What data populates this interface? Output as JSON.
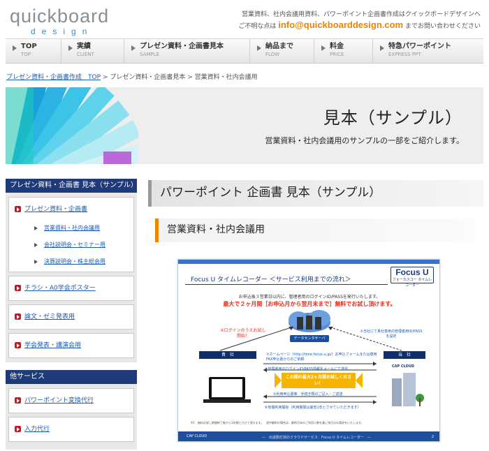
{
  "header": {
    "logo_main": "quickboard",
    "logo_sub": "design",
    "tagline": "営業資料、社内会議用資料、パワーポイント企画書作成はクイックボードデザインへ",
    "contact_prefix": "ご不明な点は",
    "contact_email": "info@quickboarddesign.com",
    "contact_suffix": "までお問い合わせください"
  },
  "nav": [
    {
      "label": "TOP",
      "sub": "TOP"
    },
    {
      "label": "実績",
      "sub": "CLIENT"
    },
    {
      "label": "プレゼン資料・企画書見本",
      "sub": "SAMPLE"
    },
    {
      "label": "納品まで",
      "sub": "FLOW"
    },
    {
      "label": "料金",
      "sub": "PRICE"
    },
    {
      "label": "特急パワーポイント",
      "sub": "EXPRESS PPT"
    }
  ],
  "breadcrumb": {
    "home": "プレゼン資料・企画書作成　TOP",
    "sep": ">",
    "level2": "プレゼン資料・企画書見本",
    "current": "営業資料・社内会議用"
  },
  "hero": {
    "title": "見本（サンプル）",
    "subtitle": "営業資料・社内会議用のサンプルの一部をご紹介します。"
  },
  "sidebar": {
    "section1_title": "プレゼン資料・企画書 見本（サンプル）",
    "main_link": "プレゼン資料・企画書",
    "sublinks": [
      "営業資料・社内会議用",
      "会社説明会・セミナー用",
      "決算説明会・株主総会用"
    ],
    "links": [
      "チラシ・A0学会ポスター",
      "論文・ゼミ発表用",
      "学会発表・講演会用"
    ],
    "section2_title": "他サービス",
    "other_links": [
      "パワーポイント変換代行",
      "入力代行"
    ]
  },
  "main": {
    "page_title": "パワーポイント 企画書 見本（サンプル）",
    "section_title": "営業資料・社内会議用"
  },
  "slide": {
    "title": "Focus U タイムレコーダー ＜サービス利用までの流れ＞",
    "logo_main": "Focus U",
    "logo_sub": "フォーカスユー タイムレコーダー",
    "desc": "お申込後３営業日以内に、管理者用のログインID/PASSを発行いたします。",
    "strong": "最大で２ヶ月間［お申込月から翌月末まで］無料でお試し頂けます。",
    "datacenter": "データセンタサーバ",
    "note_left": "④ログインのうえお試し開始！",
    "note_right": "②当社にて貴社専用の管理者用ID/PASSを設定",
    "company_left": "貴　社",
    "company_right": "当　社",
    "step1": "①ホームページ（http://time.focus-u.jp/）お申込フォームまたは専用FAX申込書からのご依頼",
    "step3": "③管理者用のログインID/PASS情報をメールにて送信",
    "promo": "この間の最大2ヶ月間お試しください！",
    "step5": "⑤利用申込書等　手続き類のご記入・ご返送",
    "step6": "⑥有償利用開始（利用期間は最低1年とさせていただきます）",
    "fine": "※1　無料お試し期間終了後から1年間とさせて頂きます。　途中解約の場合は、解約月末のご利用人数を基に残月分の請求をいたします。",
    "footer_logo": "CAP CLOUD",
    "footer_text": "―　出退勤打刻のクラウドサービス　Focus U タイムレコーダー　―",
    "footer_page": "2",
    "building_label": "CAP CLOUD"
  },
  "colors": {
    "accent_orange": "#f08300",
    "nav_blue": "#1e3a78",
    "link_blue": "#1c5bb0",
    "bullet_red": "#c7171f"
  }
}
